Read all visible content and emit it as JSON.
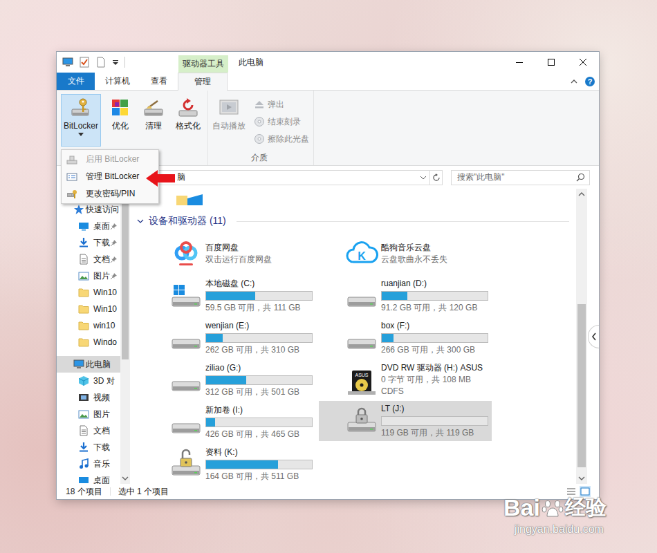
{
  "window": {
    "title": "此电脑",
    "context_tab": "驱动器工具",
    "help_label": "?"
  },
  "ribbon_tabs": [
    {
      "label": "文件",
      "selected": false,
      "kind": "file"
    },
    {
      "label": "计算机",
      "selected": false,
      "kind": "tab"
    },
    {
      "label": "查看",
      "selected": false,
      "kind": "tab"
    },
    {
      "label": "管理",
      "selected": true,
      "kind": "tab"
    }
  ],
  "ribbon_groups": [
    {
      "buttons": [
        {
          "label": "BitLocker",
          "kind": "large",
          "pressed": true,
          "disabled": false,
          "dropdown": true
        },
        {
          "label": "优化",
          "kind": "large",
          "pressed": false,
          "disabled": false,
          "dropdown": false
        },
        {
          "label": "清理",
          "kind": "large",
          "pressed": false,
          "disabled": false,
          "dropdown": false
        },
        {
          "label": "格式化",
          "kind": "large",
          "pressed": false,
          "disabled": false,
          "dropdown": false
        }
      ]
    },
    {
      "label": "介质",
      "buttons": [
        {
          "label": "自动播放",
          "kind": "large",
          "pressed": false,
          "disabled": true,
          "dropdown": false
        },
        {
          "label": "弹出",
          "kind": "small",
          "pressed": false,
          "disabled": true,
          "dropdown": false
        },
        {
          "label": "结束刻录",
          "kind": "small",
          "pressed": false,
          "disabled": true,
          "dropdown": false
        },
        {
          "label": "擦除此光盘",
          "kind": "small",
          "pressed": false,
          "disabled": true,
          "dropdown": false
        }
      ]
    }
  ],
  "dropdown_menu": [
    {
      "label": "启用 BitLocker",
      "disabled": true
    },
    {
      "label": "管理 BitLocker",
      "disabled": false
    },
    {
      "label": "更改密码/PIN",
      "disabled": false
    }
  ],
  "address_bar": {
    "text": "脑"
  },
  "search": {
    "placeholder": "搜索\"此电脑\""
  },
  "nav": [
    {
      "label": "快速访问",
      "kind": "quick-access",
      "pinned": false,
      "selected": false
    },
    {
      "label": "桌面",
      "kind": "desktop",
      "pinned": true,
      "selected": false
    },
    {
      "label": "下载",
      "kind": "downloads",
      "pinned": true,
      "selected": false
    },
    {
      "label": "文档",
      "kind": "documents",
      "pinned": true,
      "selected": false
    },
    {
      "label": "图片",
      "kind": "pictures",
      "pinned": true,
      "selected": false
    },
    {
      "label": "Win10",
      "kind": "folder",
      "pinned": false,
      "selected": false
    },
    {
      "label": "Win10",
      "kind": "folder",
      "pinned": false,
      "selected": false
    },
    {
      "label": "win10",
      "kind": "folder",
      "pinned": false,
      "selected": false
    },
    {
      "label": "Windo",
      "kind": "folder",
      "pinned": false,
      "selected": false
    },
    {
      "label": "此电脑",
      "kind": "this-pc",
      "pinned": false,
      "selected": true
    },
    {
      "label": "3D 对",
      "kind": "3d",
      "pinned": false,
      "selected": false
    },
    {
      "label": "视频",
      "kind": "videos",
      "pinned": false,
      "selected": false
    },
    {
      "label": "图片",
      "kind": "pictures",
      "pinned": false,
      "selected": false
    },
    {
      "label": "文档",
      "kind": "documents",
      "pinned": false,
      "selected": false
    },
    {
      "label": "下载",
      "kind": "downloads",
      "pinned": false,
      "selected": false
    },
    {
      "label": "音乐",
      "kind": "music",
      "pinned": false,
      "selected": false
    },
    {
      "label": "桌面",
      "kind": "desktop",
      "pinned": false,
      "selected": false
    }
  ],
  "section": {
    "label": "设备和驱动器 (11)",
    "expanded": true
  },
  "items": [
    {
      "name": "百度网盘",
      "kind": "app-baidu",
      "detail": "双击运行百度网盘",
      "selected": false
    },
    {
      "name": "酷狗音乐云盘",
      "kind": "app-kugou",
      "icon_label": "K",
      "detail": "云盘歌曲永不丢失",
      "selected": false
    },
    {
      "name": "本地磁盘 (C:)",
      "kind": "system",
      "level": 0.464,
      "detail": "59.5 GB 可用，共 111 GB",
      "selected": false
    },
    {
      "name": "ruanjian (D:)",
      "kind": "disk",
      "level": 0.24,
      "detail": "91.2 GB 可用，共 120 GB",
      "selected": false
    },
    {
      "name": "wenjian (E:)",
      "kind": "disk",
      "level": 0.155,
      "detail": "262 GB 可用，共 310 GB",
      "selected": false
    },
    {
      "name": "box (F:)",
      "kind": "disk",
      "level": 0.113,
      "detail": "266 GB 可用，共 300 GB",
      "selected": false
    },
    {
      "name": "ziliao (G:)",
      "kind": "disk",
      "level": 0.377,
      "detail": "312 GB 可用，共 501 GB",
      "selected": false
    },
    {
      "name": "DVD RW 驱动器 (H:) ASUS",
      "kind": "optical",
      "icon_label": "ASUS",
      "detail": "0 字节 可用，共 108 MB",
      "detail2": "CDFS",
      "selected": false
    },
    {
      "name": "新加卷 (I:)",
      "kind": "disk",
      "level": 0.084,
      "detail": "426 GB 可用，共 465 GB",
      "selected": false
    },
    {
      "name": "LT (J:)",
      "kind": "bitlocker",
      "locked": true,
      "level": 0,
      "detail": "119 GB 可用，共 119 GB",
      "selected": true
    },
    {
      "name": "资料 (K:)",
      "kind": "bitlocker",
      "locked": false,
      "level": 0.679,
      "detail": "164 GB 可用，共 511 GB",
      "selected": false
    }
  ],
  "status_bar": {
    "count": "18 个项目",
    "selection": "选中 1 个项目"
  },
  "watermark": {
    "brand": "Bai",
    "brand_suffix": "经验",
    "url": "jingyan.baidu.com"
  }
}
